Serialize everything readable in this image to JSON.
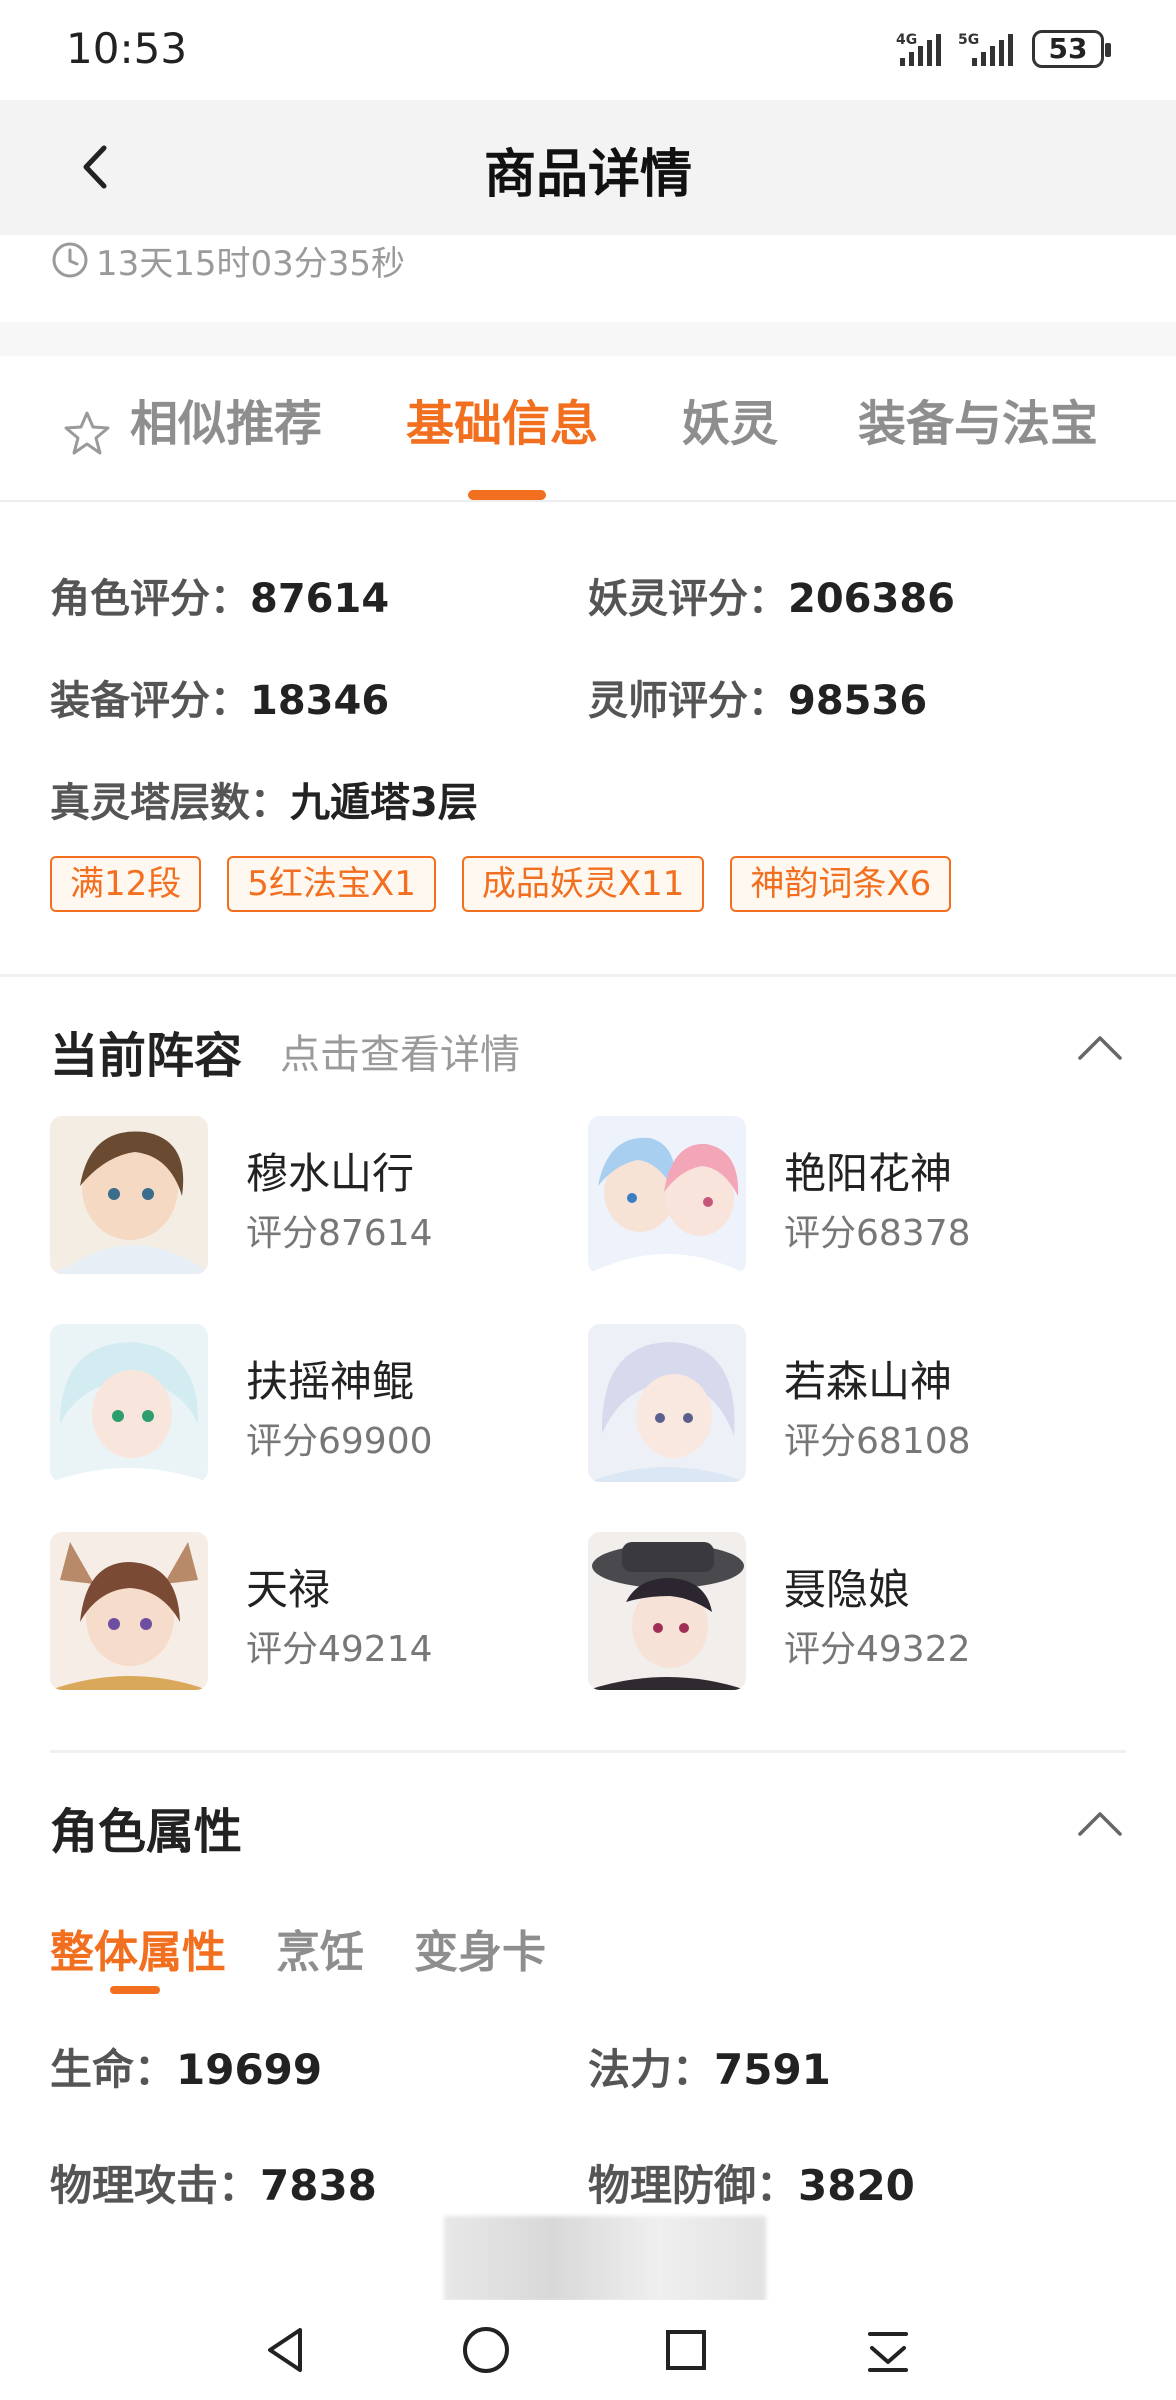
{
  "status_bar": {
    "time": "10:53",
    "battery": "53",
    "net1": "4G",
    "net2": "5G"
  },
  "header": {
    "title": "商品详情"
  },
  "countdown": {
    "text": "13天15时03分35秒"
  },
  "tabs": [
    {
      "label": "相似推荐"
    },
    {
      "label": "基础信息"
    },
    {
      "label": "妖灵"
    },
    {
      "label": "装备与法宝"
    }
  ],
  "stats": {
    "role_score_label": "角色评分：",
    "role_score": "87614",
    "yaoling_score_label": "妖灵评分：",
    "yaoling_score": "206386",
    "equip_score_label": "装备评分：",
    "equip_score": "18346",
    "lingshi_score_label": "灵师评分：",
    "lingshi_score": "98536",
    "tower_label": "真灵塔层数：",
    "tower": "九遁塔3层"
  },
  "tags": [
    "满12段",
    "5红法宝X1",
    "成品妖灵X11",
    "神韵词条X6"
  ],
  "lineup": {
    "title": "当前阵容",
    "subtitle": "点击查看详情",
    "members": [
      {
        "name": "穆水山行",
        "score": "评分87614"
      },
      {
        "name": "艳阳花神",
        "score": "评分68378"
      },
      {
        "name": "扶摇神鲲",
        "score": "评分69900"
      },
      {
        "name": "若森山神",
        "score": "评分68108"
      },
      {
        "name": "天禄",
        "score": "评分49214"
      },
      {
        "name": "聂隐娘",
        "score": "评分49322"
      }
    ]
  },
  "attributes": {
    "title": "角色属性",
    "subtabs": [
      "整体属性",
      "烹饪",
      "变身卡"
    ],
    "hp_label": "生命：",
    "hp": "19699",
    "mp_label": "法力：",
    "mp": "7591",
    "patk_label": "物理攻击：",
    "patk": "7838",
    "pdef_label": "物理防御：",
    "pdef": "3820"
  },
  "colors": {
    "accent": "#f26f1f",
    "muted": "#8e8e8e"
  }
}
